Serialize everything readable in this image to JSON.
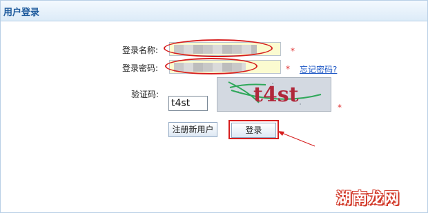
{
  "panel": {
    "title": "用户登录"
  },
  "form": {
    "username_label": "登录名称:",
    "password_label": "登录密码:",
    "captcha_label": "验证码:",
    "captcha_value": "t4st",
    "captcha_image_text": "t4st",
    "required_mark": "*",
    "forgot_link": "忘记密码?"
  },
  "buttons": {
    "register": "注册新用户",
    "login": "登录"
  },
  "watermark": "湖南龙网",
  "colors": {
    "annotation": "#d61e1e",
    "title": "#1e5a9c",
    "link": "#1a55c4",
    "required": "#e03030"
  }
}
